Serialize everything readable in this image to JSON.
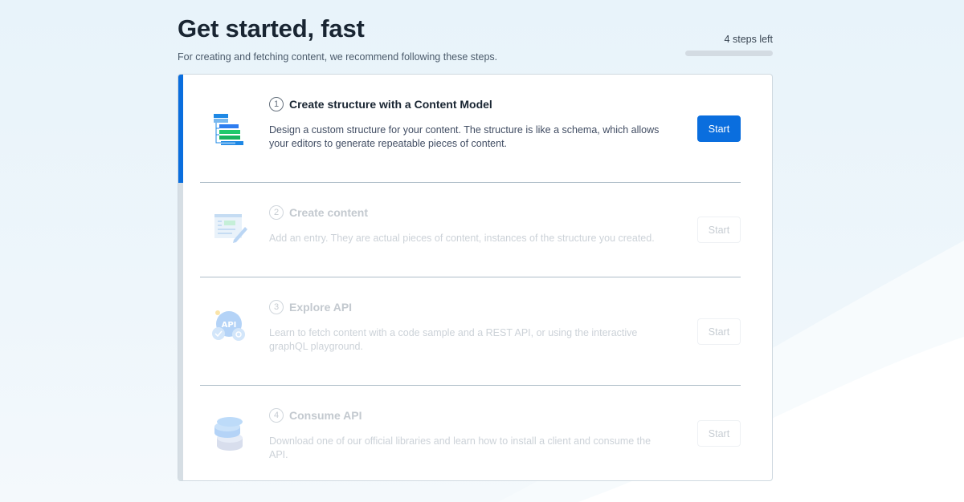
{
  "header": {
    "title": "Get started, fast",
    "subtitle": "For creating and fetching content, we recommend following these steps.",
    "steps_left": "4 steps left",
    "progress": 0
  },
  "colors": {
    "accent": "#0a6ede",
    "heading": "#192532",
    "muted_text": "#414d63",
    "divider": "#aebdc8"
  },
  "steps": [
    {
      "number": "1",
      "title": "Create structure with a Content Model",
      "description": "Design a custom structure for your content. The structure is like a schema, which allows your editors to generate repeatable pieces of content.",
      "button": "Start",
      "icon": "content-model-icon",
      "active": true
    },
    {
      "number": "2",
      "title": "Create content",
      "description": "Add an entry. They are actual pieces of content, instances of the structure you created.",
      "button": "Start",
      "icon": "create-content-icon",
      "active": false
    },
    {
      "number": "3",
      "title": "Explore API",
      "description": "Learn to fetch content with a code sample and a REST API, or using the interactive graphQL playground.",
      "button": "Start",
      "icon": "api-icon",
      "active": false
    },
    {
      "number": "4",
      "title": "Consume API",
      "description": "Download one of our official libraries and learn how to install a client and consume the API.",
      "button": "Start",
      "icon": "database-icon",
      "active": false
    }
  ]
}
